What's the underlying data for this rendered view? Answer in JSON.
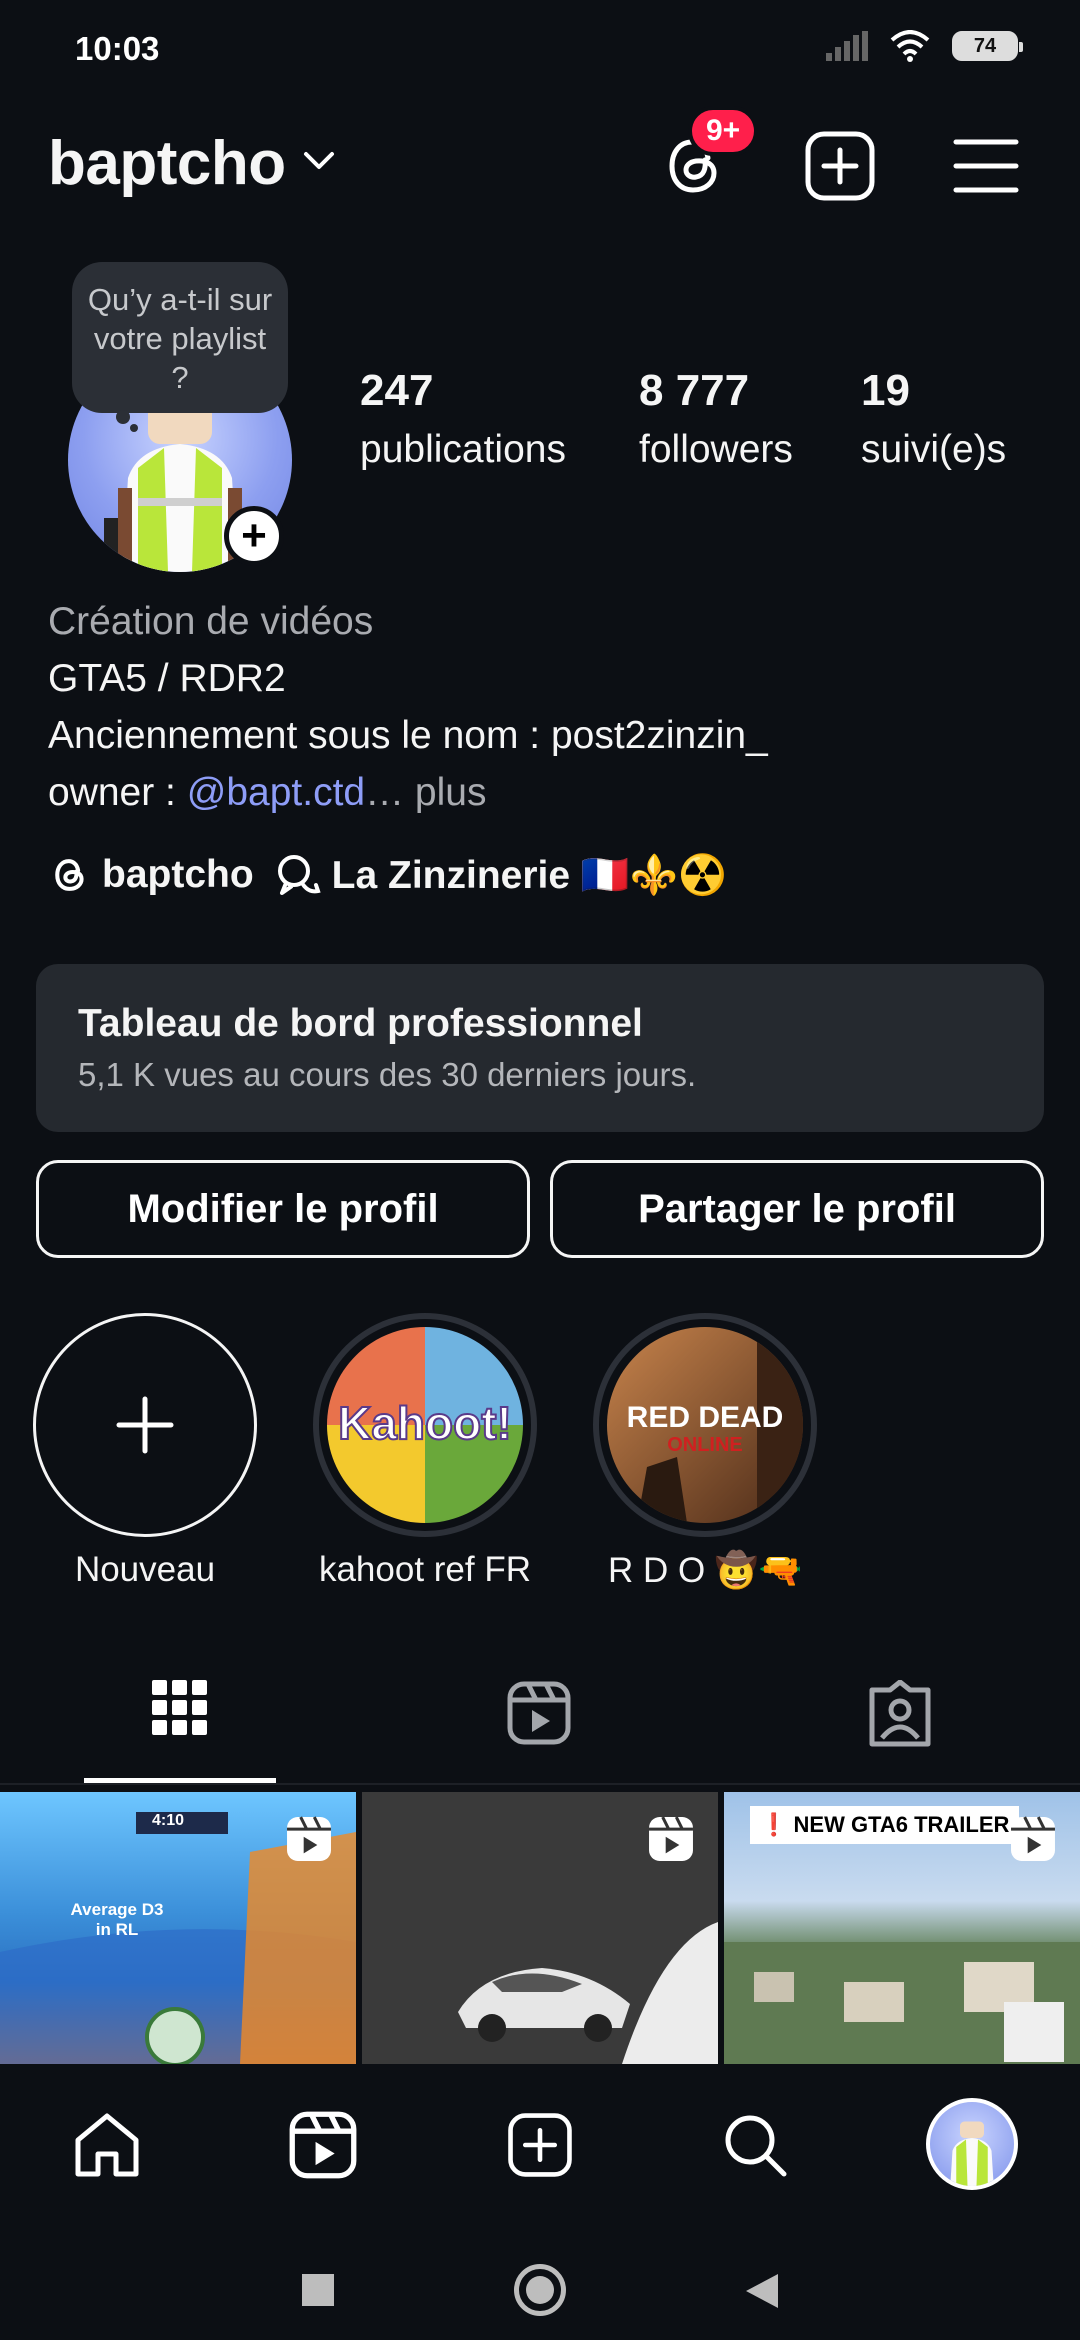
{
  "status": {
    "time": "10:03",
    "battery": "74"
  },
  "header": {
    "username": "baptcho",
    "notification_badge": "9+"
  },
  "note": {
    "text": "Qu’y a-t-il sur votre playlist ?"
  },
  "stats": [
    {
      "value": "247",
      "label": "publications"
    },
    {
      "value": "8 777",
      "label": "followers"
    },
    {
      "value": "19",
      "label": "suivi(e)s"
    }
  ],
  "bio": {
    "category": "Création de vidéos",
    "line1": "GTA5 / RDR2",
    "line2": "Anciennement sous le nom : post2zinzin_",
    "line3_prefix": "owner : ",
    "mention": "@bapt.ctd",
    "ellipsis": "…",
    "more": " plus"
  },
  "links": {
    "threads": "baptcho",
    "channel": "La Zinzinerie 🇫🇷⚜️☢️"
  },
  "dashboard": {
    "title": "Tableau de bord professionnel",
    "subtitle": "5,1 K vues au cours des 30 derniers jours."
  },
  "actions": {
    "edit": "Modifier le profil",
    "share": "Partager le profil"
  },
  "highlights": [
    {
      "label": "Nouveau",
      "icon": "plus-icon"
    },
    {
      "label": "kahoot ref FR",
      "thumb_text": "Kahoot!"
    },
    {
      "label": "R D O 🤠🔫",
      "thumb_text_1": "RED DEAD",
      "thumb_text_2": "ONLINE"
    }
  ],
  "tabs": [
    "grid-icon",
    "reels-icon",
    "tagged-icon"
  ],
  "grid": [
    {
      "caption": "Average D3 in RL",
      "score": "4:10",
      "icon": "reel-icon"
    },
    {
      "icon": "reel-icon"
    },
    {
      "caption": "❗ NEW GTA6 TRAILER",
      "icon": "reel-icon"
    }
  ],
  "colors": {
    "background": "#0c0f14",
    "badge": "#ff1f4b",
    "mention": "#8e9df7",
    "card": "#25292f"
  }
}
